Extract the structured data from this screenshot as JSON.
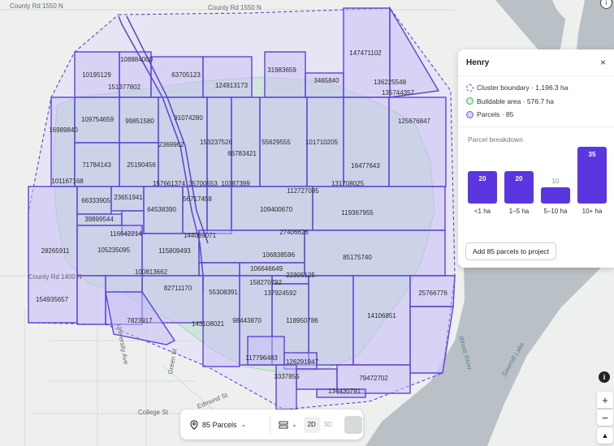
{
  "roads": {
    "county_rd_1550": "County Rd 1550 N",
    "county_rd_1400": "County Rd 1400 N",
    "university_ave": "University Ave",
    "green_st": "Green St",
    "edmond_st": "Edmond St",
    "college_st": "College St"
  },
  "water": {
    "illinois_river": "Illinois River",
    "sawmill_lake": "Sawmill Lake"
  },
  "parcels": [
    "108884000",
    "10195129",
    "63705123",
    "151377802",
    "124913173",
    "31983659",
    "147471102",
    "3465840",
    "136225548",
    "135744357",
    "109754659",
    "99851580",
    "91074280",
    "16989840",
    "125676847",
    "2369962",
    "153237526",
    "66783421",
    "55629555",
    "101710205",
    "71784143",
    "25190456",
    "16477643",
    "101167168",
    "157661374",
    "35700553",
    "10387399",
    "131708025",
    "112727085",
    "66333905",
    "23651941",
    "56717458",
    "64538390",
    "109400670",
    "119367955",
    "39899544",
    "116642214",
    "144069071",
    "27406626",
    "28265911",
    "105235095",
    "115809493",
    "106838596",
    "85175740",
    "100813662",
    "106646649",
    "22305125",
    "82711170",
    "55308391",
    "158270792",
    "137924592",
    "25766776",
    "154935657",
    "7823917",
    "14106851",
    "143108021",
    "98443870",
    "118950786",
    "117796483",
    "126291947",
    "3337855",
    "79472702",
    "134430791"
  ],
  "panel": {
    "title": "Henry",
    "close": "×",
    "legend": [
      {
        "label": "Cluster boundary · 1,196.3 ha",
        "icon": "dashed-circle"
      },
      {
        "label": "Buildable area · 576.7 ha",
        "icon": "green-circle"
      },
      {
        "label": "Parcels · 85",
        "icon": "purple-circle"
      }
    ],
    "breakdown_title": "Parcel breakdown",
    "add_button": "Add 85 parcels to project"
  },
  "chart_data": {
    "type": "bar",
    "title": "Parcel breakdown",
    "categories": [
      "<1 ha",
      "1–5 ha",
      "5–10 ha",
      "10+ ha"
    ],
    "values": [
      20,
      20,
      10,
      35
    ],
    "colors": {
      "bar": "#5b36e0"
    }
  },
  "toolbar": {
    "parcels_label": "85 Parcels",
    "mode_2d": "2D",
    "mode_3d": "3D"
  },
  "controls": {
    "zoom_in": "+",
    "zoom_out": "−",
    "compass": "▲",
    "info": "i"
  },
  "colors": {
    "parcel_stroke": "#5a44d6",
    "parcel_fill": "#c9c0f5",
    "buildable_fill": "#cfe5da",
    "river": "#b9c1c7"
  }
}
